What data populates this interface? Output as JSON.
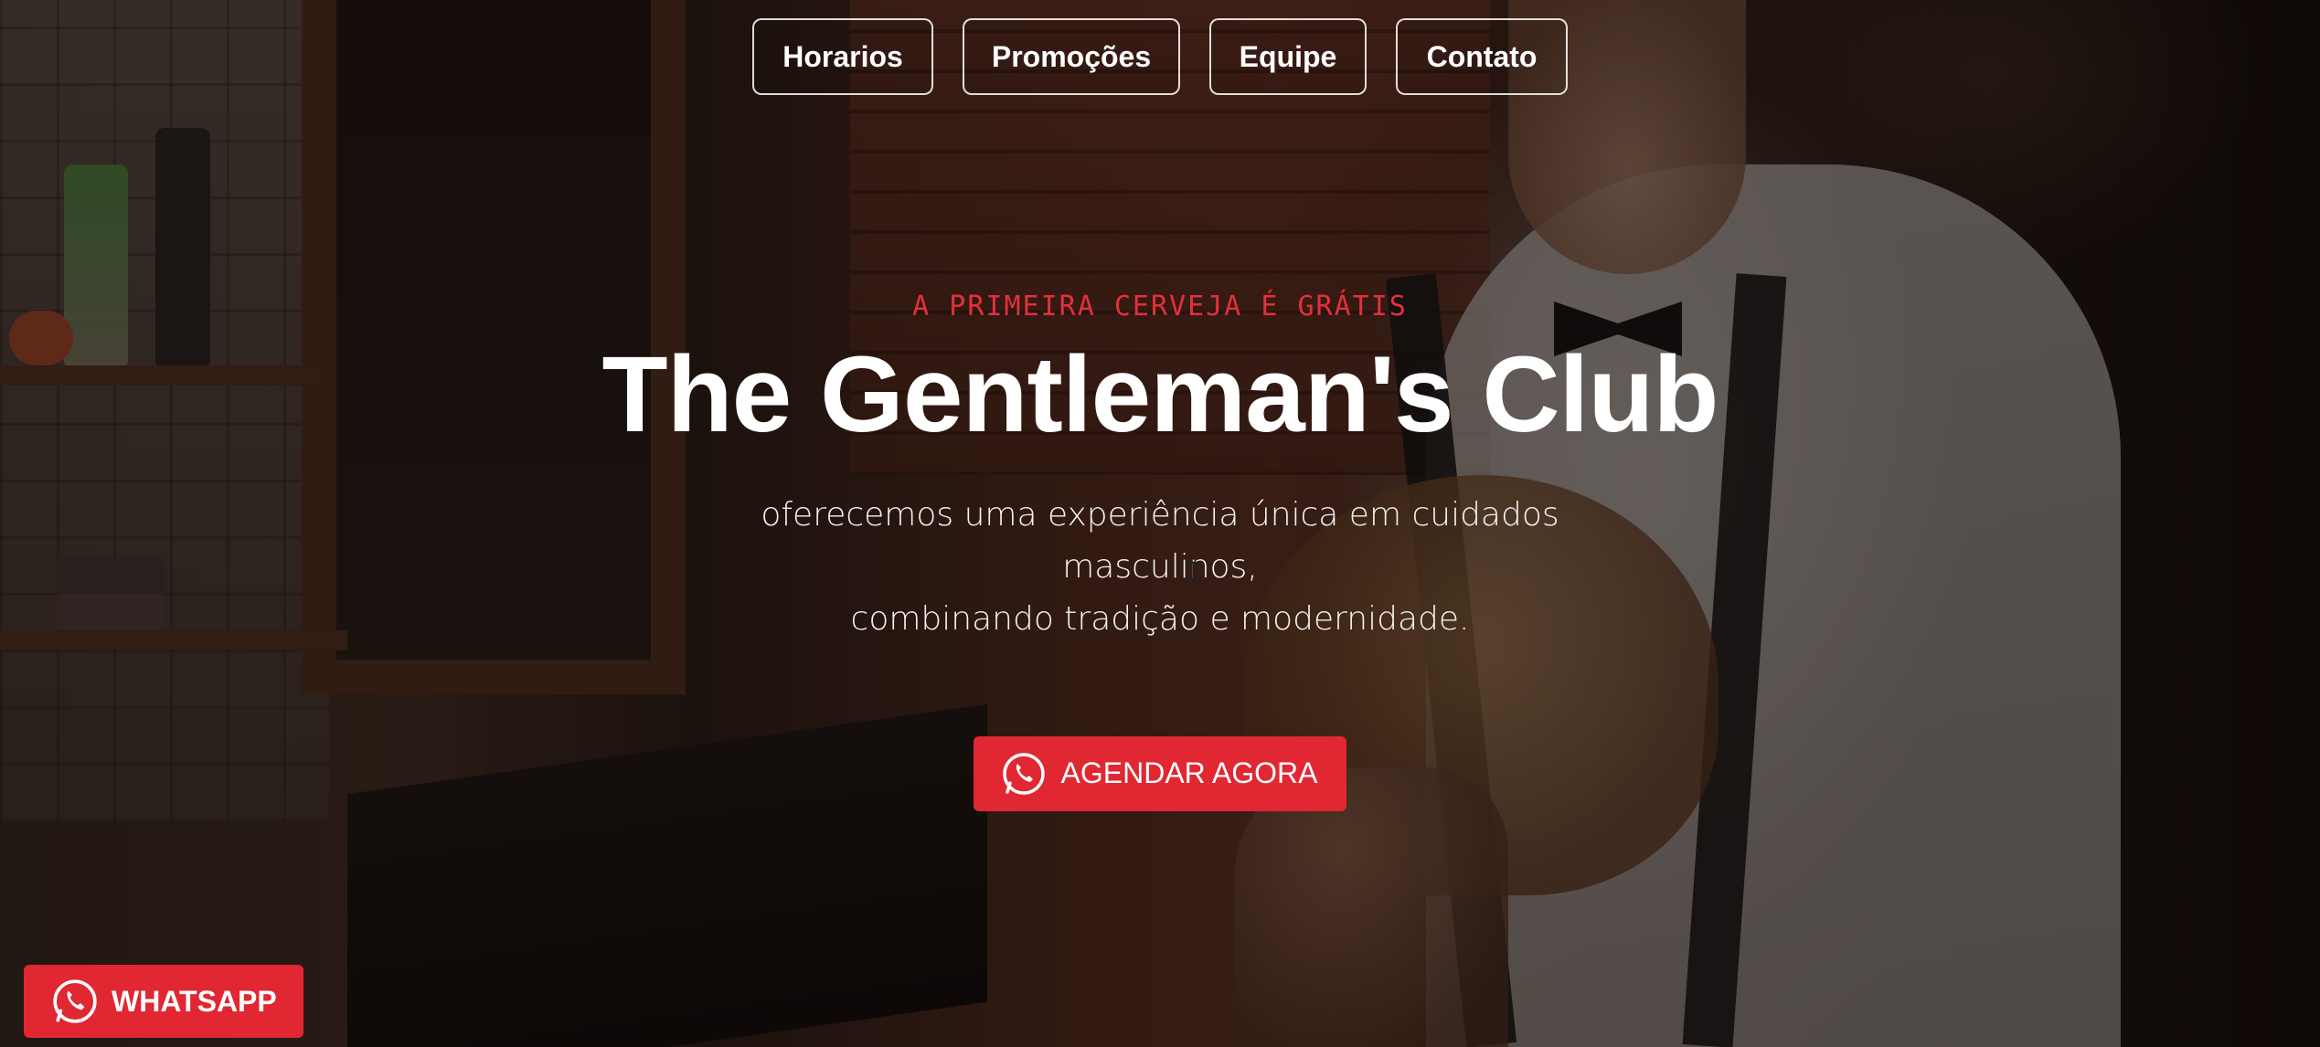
{
  "nav": {
    "items": [
      {
        "label": "Horarios"
      },
      {
        "label": "Promoções"
      },
      {
        "label": "Equipe"
      },
      {
        "label": "Contato"
      }
    ]
  },
  "hero": {
    "eyebrow": "A PRIMEIRA CERVEJA É GRÁTIS",
    "title": "The Gentleman's Club",
    "subtitle_line1": "oferecemos uma experiência única em cuidados masculinos,",
    "subtitle_line2": "combinando tradição e modernidade.",
    "cta_label": "AGENDAR AGORA",
    "cta_icon": "whatsapp-icon"
  },
  "floating": {
    "whatsapp_label": "WHATSAPP",
    "icon": "whatsapp-icon"
  },
  "colors": {
    "accent": "#e02732",
    "eyebrow": "#e3303b",
    "text": "#ffffff"
  }
}
